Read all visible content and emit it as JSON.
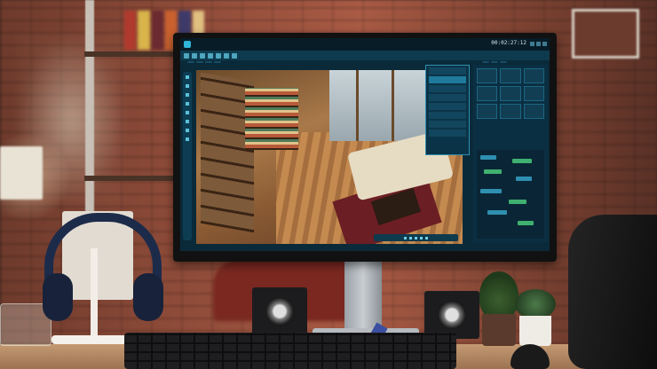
{
  "scene": {
    "description_objects": [
      "brick-wall",
      "monitor",
      "speakers",
      "keyboard",
      "headphones",
      "plants",
      "office-chair"
    ]
  },
  "screen": {
    "timecode": "00:02:27:12",
    "menu_items": [
      "",
      "",
      "",
      "",
      "",
      "",
      "",
      "",
      ""
    ],
    "tabs": [
      "",
      "",
      "",
      "",
      "",
      "",
      "",
      ""
    ],
    "right_tabs": [
      "",
      "",
      ""
    ]
  },
  "colors": {
    "ui_accent": "#2fb6d8",
    "ui_panel": "#0b2f42",
    "ui_bg": "#0a2a3a",
    "brick": "#8c4a38"
  }
}
